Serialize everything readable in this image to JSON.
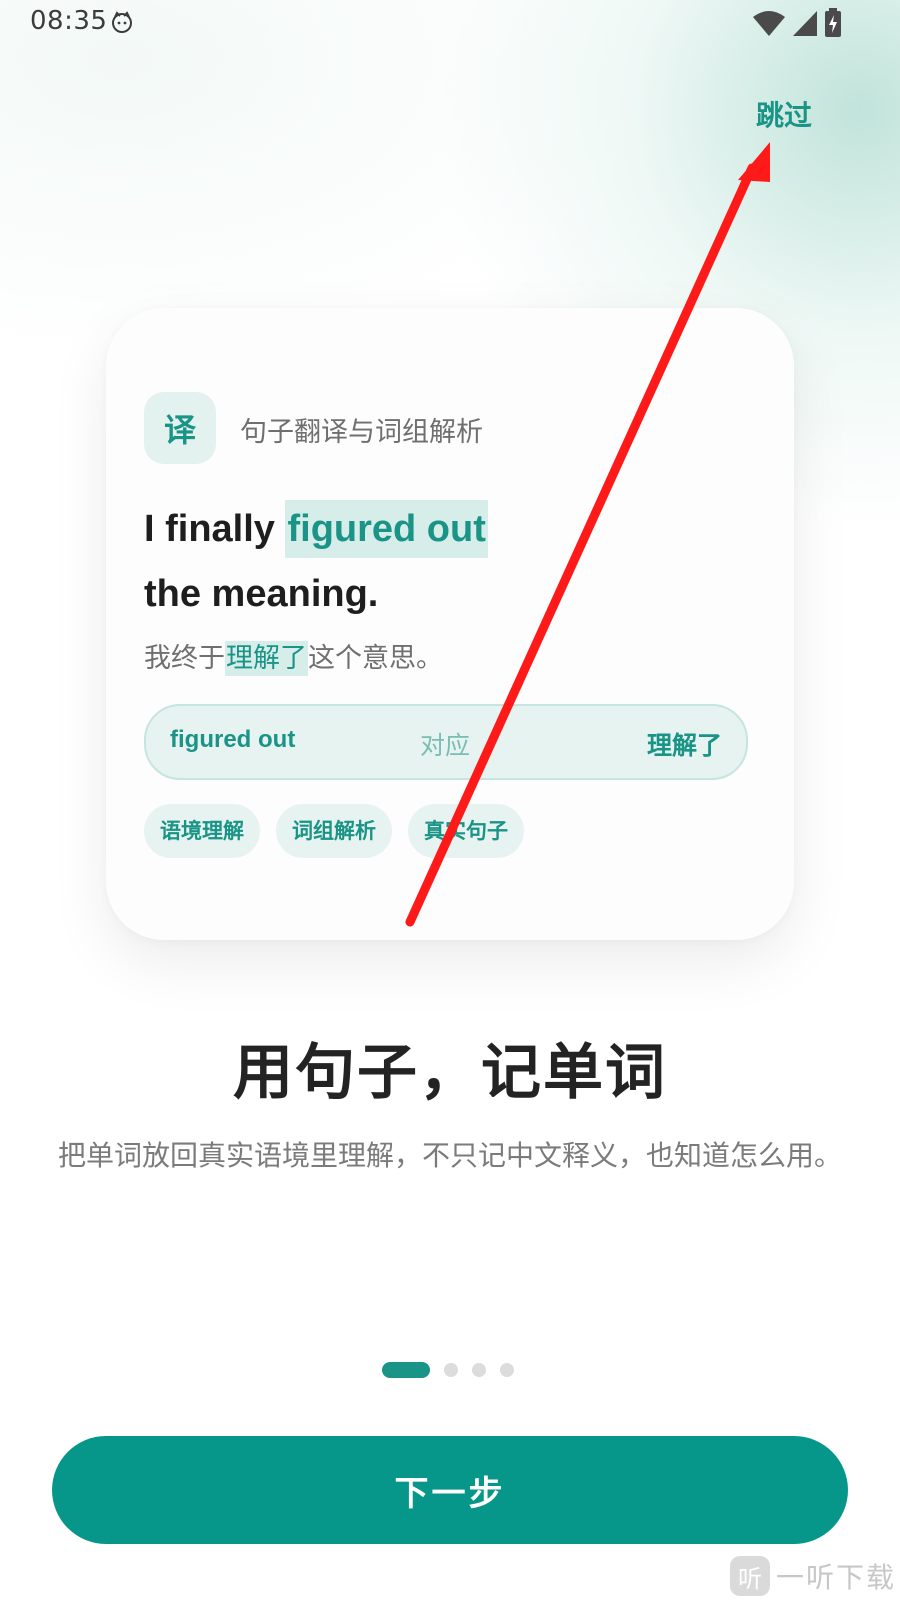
{
  "status_bar": {
    "time": "08:35",
    "icons": [
      "cat-notification-icon",
      "wifi-icon",
      "signal-icon",
      "battery-charging-icon"
    ]
  },
  "header": {
    "skip_label": "跳过"
  },
  "card": {
    "badge": "译",
    "heading": "句子翻译与词组解析",
    "sentence_en": {
      "prefix": "I finally ",
      "highlight": "figured out",
      "line2": "the meaning."
    },
    "sentence_zh": {
      "prefix": "我终于",
      "highlight": "理解了",
      "suffix": "这个意思。"
    },
    "pair": {
      "en": "figured out",
      "relation": "对应",
      "zh": "理解了"
    },
    "tags": [
      "语境理解",
      "词组解析",
      "真实句子"
    ]
  },
  "main": {
    "title": "用句子，记单词",
    "description": "把单词放回真实语境里理解，不只记中文释义，也知道怎么用。"
  },
  "pager": {
    "total": 4,
    "active": 1
  },
  "footer": {
    "next_label": "下一步"
  },
  "watermark": {
    "logo": "听",
    "text": "一听下载"
  },
  "colors": {
    "accent": "#06978a",
    "accent_light": "#e6f3f1",
    "annotation": "#ff1a1a"
  }
}
